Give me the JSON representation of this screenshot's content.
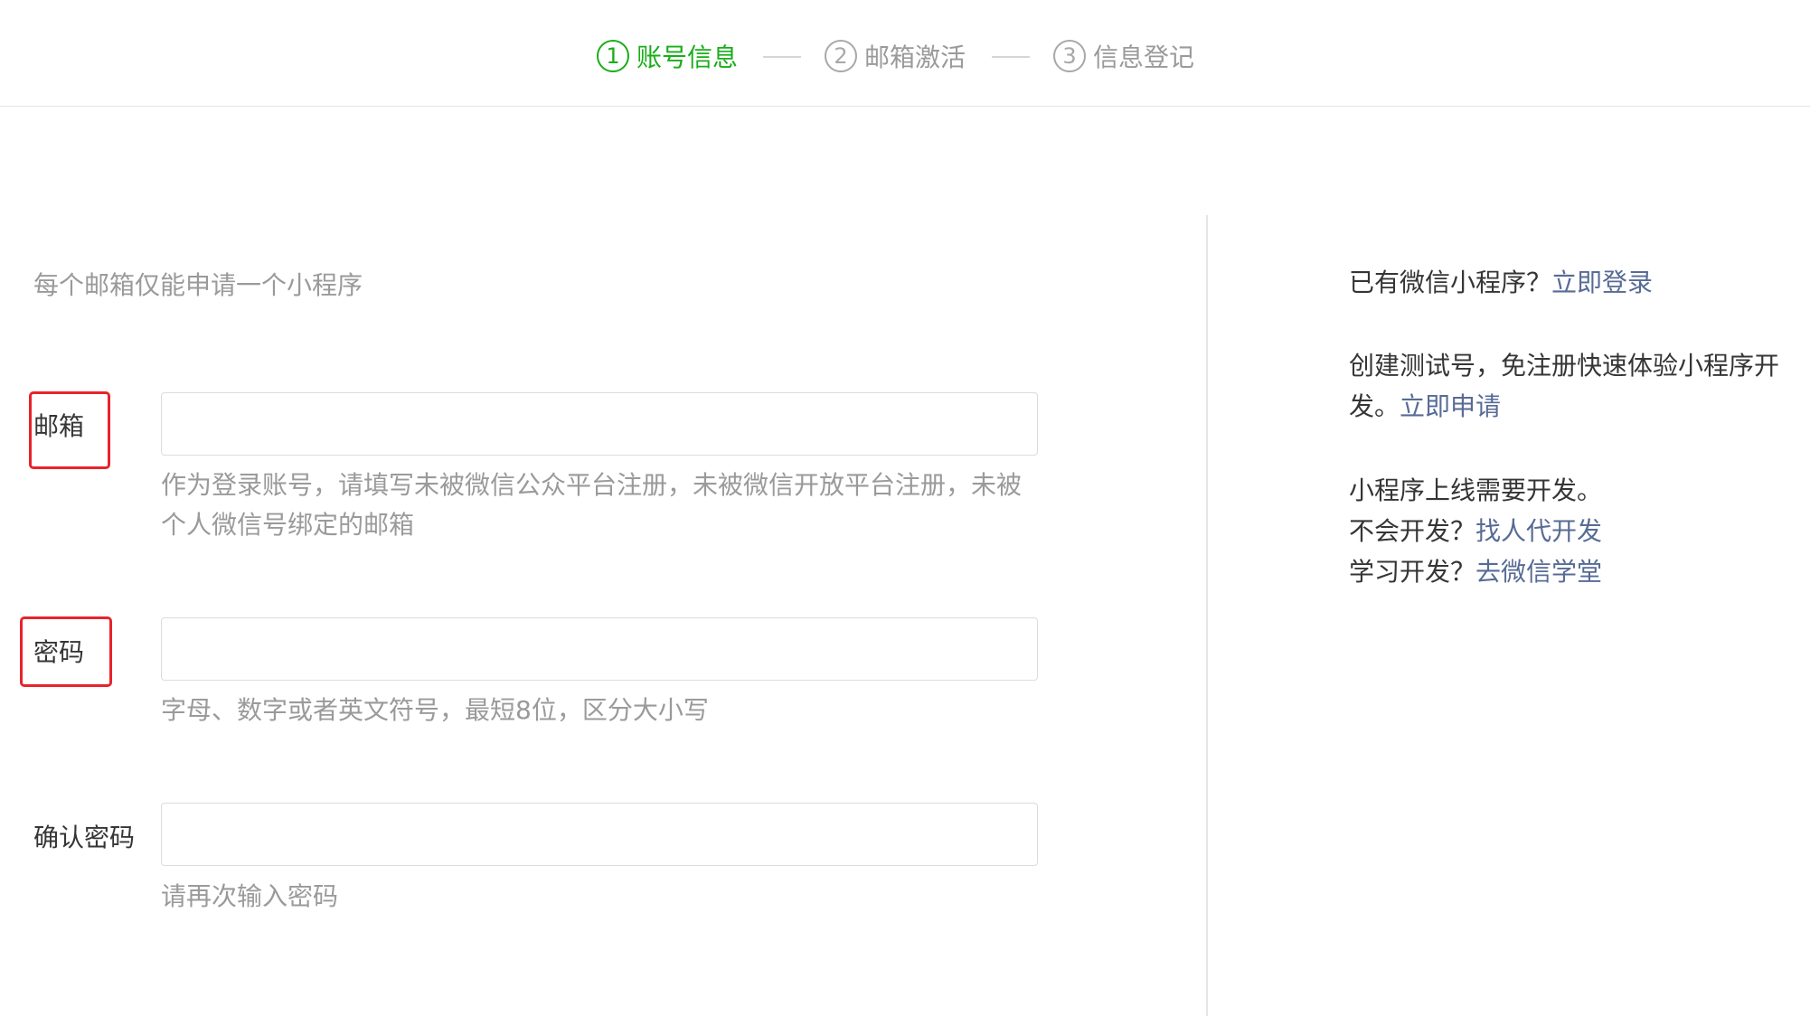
{
  "steps": [
    {
      "num": "1",
      "label": "账号信息",
      "active": true
    },
    {
      "num": "2",
      "label": "邮箱激活",
      "active": false
    },
    {
      "num": "3",
      "label": "信息登记",
      "active": false
    }
  ],
  "form": {
    "tip": "每个邮箱仅能申请一个小程序",
    "email": {
      "label": "邮箱",
      "value": "",
      "placeholder": "",
      "tip": "作为登录账号，请填写未被微信公众平台注册，未被微信开放平台注册，未被个人微信号绑定的邮箱"
    },
    "password": {
      "label": "密码",
      "value": "",
      "placeholder": "",
      "tip": "字母、数字或者英文符号，最短8位，区分大小写"
    },
    "confirm": {
      "label": "确认密码",
      "value": "",
      "placeholder": "",
      "tip": "请再次输入密码"
    }
  },
  "side": {
    "have_account": "已有微信小程序？",
    "login_link": "立即登录",
    "test_text": "创建测试号，免注册快速体验小程序开发。",
    "apply_link": "立即申请",
    "dev_needed": "小程序上线需要开发。",
    "no_dev": "不会开发？",
    "find_dev_link": "找人代开发",
    "learn_dev": "学习开发？",
    "school_link": "去微信学堂"
  },
  "colors": {
    "accent_green": "#1aad19",
    "link_blue": "#576b95",
    "highlight_red": "#e8232b",
    "muted_text": "#9a9a9a"
  }
}
